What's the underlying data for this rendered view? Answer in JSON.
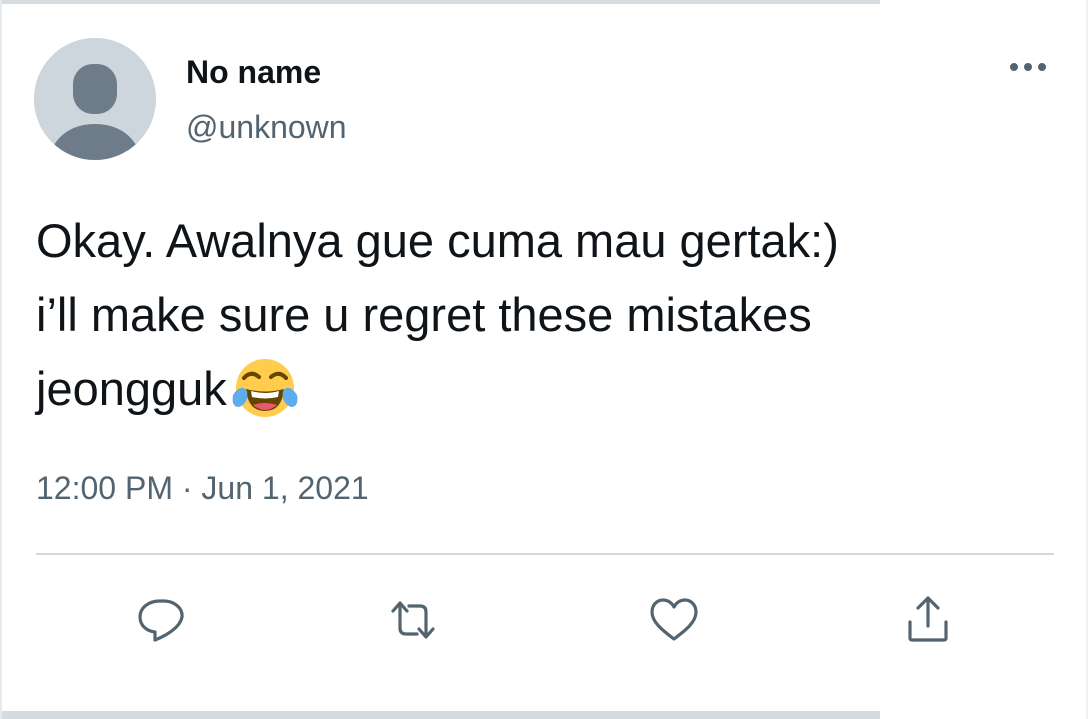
{
  "user": {
    "display_name": "No name",
    "handle": "@unknown",
    "avatar": "default-avatar-icon"
  },
  "tweet": {
    "lines": [
      "Okay. Awalnya gue cuma mau gertak:)",
      "i’ll make sure u regret these mistakes",
      "jeongguk"
    ],
    "emoji": "face-with-tears-of-joy",
    "timestamp": "12:00 PM · Jun 1, 2021"
  },
  "actions": [
    "reply-icon",
    "retweet-icon",
    "like-icon",
    "share-icon"
  ],
  "menu": {
    "icon": "more-icon"
  },
  "colors": {
    "text_primary": "#0f1419",
    "text_secondary": "#536471",
    "icon": "#536471",
    "divider": "#cfd9de",
    "avatar_bg": "#cdd5dd",
    "avatar_figure": "#6e7b88"
  }
}
